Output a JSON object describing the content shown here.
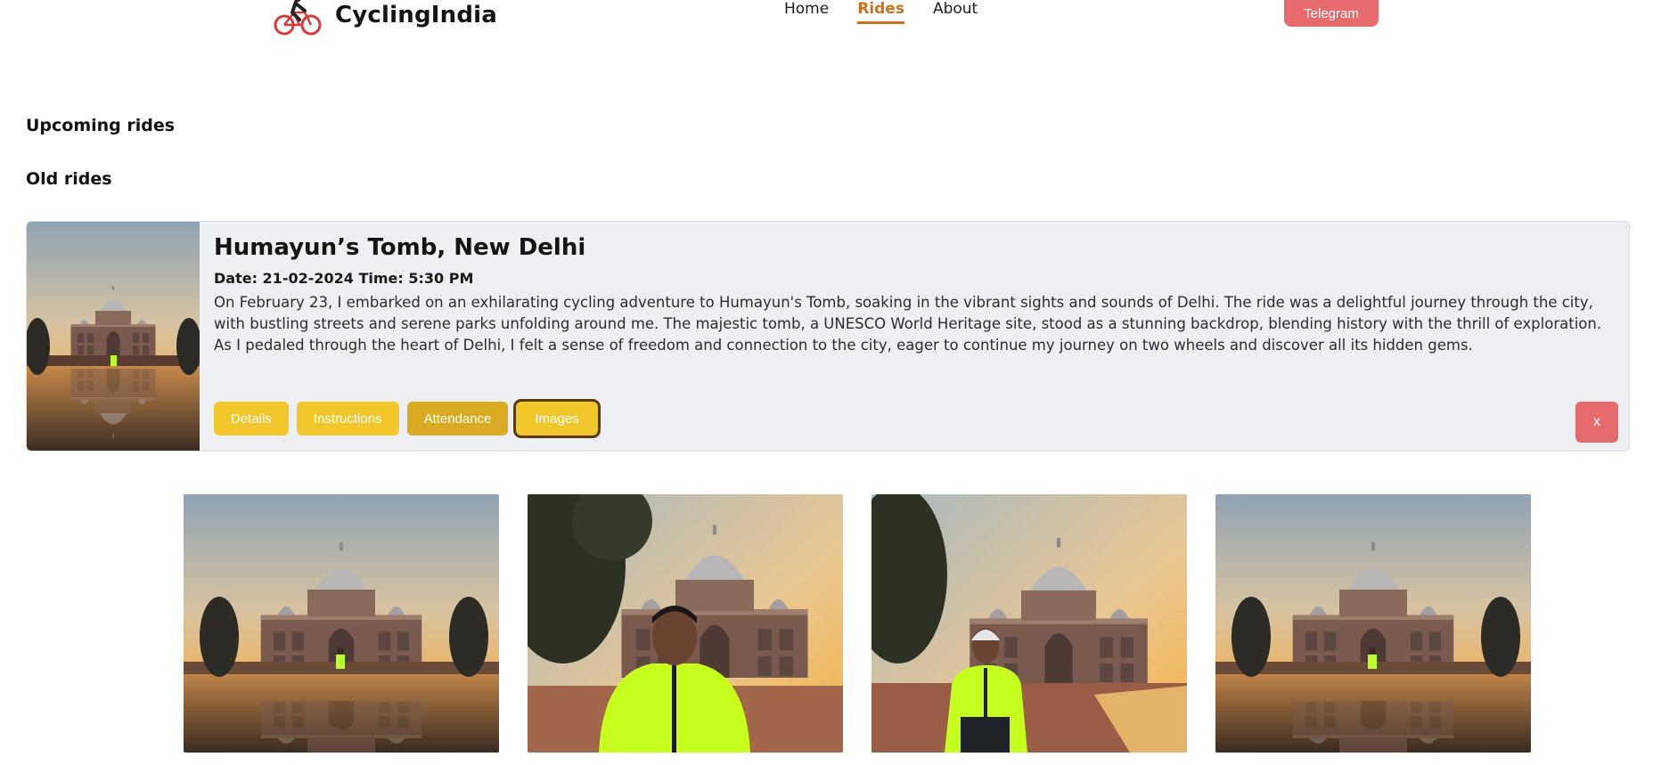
{
  "header": {
    "brand_name": "CyclingIndia",
    "nav": [
      {
        "label": "Home",
        "active": false
      },
      {
        "label": "Rides",
        "active": true
      },
      {
        "label": "About",
        "active": false
      }
    ],
    "telegram_label": "Telegram",
    "accent_color": "#c9711f"
  },
  "sections": {
    "upcoming_heading": "Upcoming rides",
    "old_heading": "Old rides"
  },
  "ride": {
    "title": "Humayun’s Tomb, New Delhi",
    "date_time": "Date: 21-02-2024 Time: 5:30 PM",
    "description": "On February 23, I embarked on an exhilarating cycling adventure to Humayun's Tomb, soaking in the vibrant sights and sounds of Delhi. The ride was a delightful journey through the city, with bustling streets and serene parks unfolding around me. The majestic tomb, a UNESCO World Heritage site, stood as a stunning backdrop, blending history with the thrill of exploration. As I pedaled through the heart of Delhi, I felt a sense of freedom and connection to the city, eager to continue my journey on two wheels and discover all its hidden gems.",
    "actions": [
      "Details",
      "Instructions",
      "Attendance",
      "Images"
    ],
    "selected_action": "Images",
    "close_label": "x"
  },
  "gallery": {
    "photos": [
      "humayun-tomb-reflection-cyclist",
      "cyclist-portrait-closeup",
      "cyclist-standing-helmet",
      "humayun-tomb-reflection-cyclist"
    ]
  }
}
